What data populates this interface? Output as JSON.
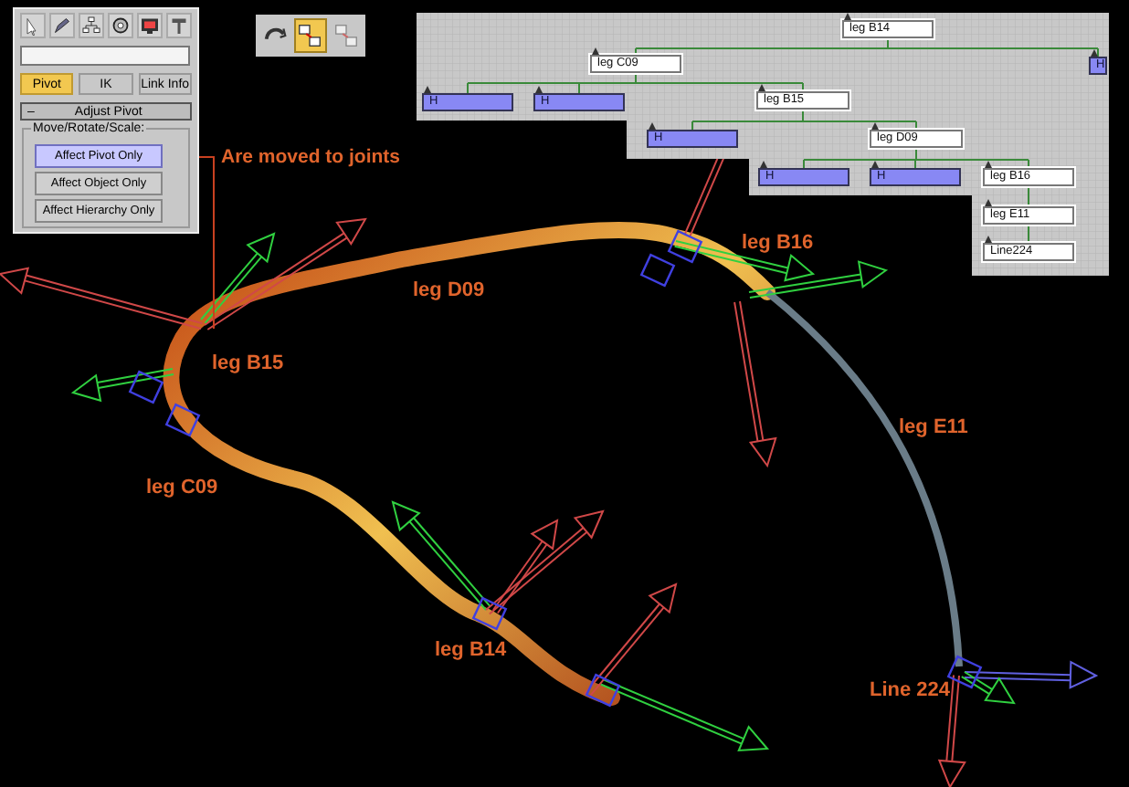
{
  "command_panel": {
    "subtabs": [
      {
        "label": "Pivot",
        "selected": true
      },
      {
        "label": "IK",
        "selected": false
      },
      {
        "label": "Link Info",
        "selected": false
      }
    ],
    "rollout": {
      "toggle": "–",
      "title": "Adjust Pivot",
      "expanded": true
    },
    "group": {
      "title": "Move/Rotate/Scale:",
      "buttons": [
        {
          "label": "Affect Pivot Only",
          "selected": true
        },
        {
          "label": "Affect Object Only",
          "selected": false
        },
        {
          "label": "Affect Hierarchy Only",
          "selected": false
        }
      ]
    }
  },
  "toolbar": [
    {
      "selected": false
    },
    {
      "selected": true
    },
    {
      "selected": false
    }
  ],
  "annotation": "Are moved to joints",
  "schematic": {
    "root": {
      "label": "leg B14",
      "kind": "bone",
      "children": [
        {
          "label": "leg C09",
          "kind": "bone",
          "children": [
            {
              "label": "H",
              "kind": "helper"
            },
            {
              "label": "H",
              "kind": "helper"
            },
            {
              "label": "leg B15",
              "kind": "bone",
              "children": [
                {
                  "label": "H",
                  "kind": "helper"
                },
                {
                  "label": "leg D09",
                  "kind": "bone",
                  "children": [
                    {
                      "label": "H",
                      "kind": "helper"
                    },
                    {
                      "label": "H",
                      "kind": "helper"
                    },
                    {
                      "label": "leg B16",
                      "kind": "bone",
                      "children": [
                        {
                          "label": "leg E11",
                          "kind": "bone",
                          "children": [
                            {
                              "label": "Line224",
                              "kind": "bone"
                            }
                          ]
                        }
                      ]
                    }
                  ]
                }
              ]
            }
          ]
        },
        {
          "label": "H",
          "kind": "helper"
        }
      ]
    }
  },
  "viewport_labels": [
    "leg D09",
    "leg B15",
    "leg B16",
    "leg C09",
    "leg E11",
    "leg B14",
    "Line 224"
  ]
}
